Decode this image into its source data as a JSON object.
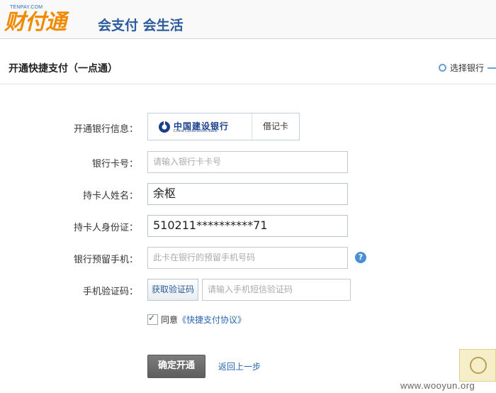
{
  "header": {
    "logo_small": "TENPAY.COM",
    "logo_main": "财付通",
    "slogan": "会支付 会生活"
  },
  "title_bar": {
    "title": "开通快捷支付（一点通）",
    "step_label": "选择银行"
  },
  "form": {
    "bank_info": {
      "label": "开通银行信息：",
      "bank_name": "中国建设银行",
      "bank_name_en": "China Construction Bank",
      "card_type": "借记卡"
    },
    "card_number": {
      "label": "银行卡号：",
      "placeholder": "请输入银行卡卡号",
      "value": ""
    },
    "holder_name": {
      "label": "持卡人姓名：",
      "value": "余枢"
    },
    "id_number": {
      "label": "持卡人身份证：",
      "value": "510211**********71"
    },
    "phone": {
      "label": "银行预留手机：",
      "placeholder": "此卡在银行的预留手机号码",
      "help_icon": "?"
    },
    "sms_code": {
      "label": "手机验证码：",
      "button_label": "获取验证码",
      "placeholder": "请输入手机短信验证码"
    },
    "agreement": {
      "checked": true,
      "prefix": "同意",
      "link_text": "《快捷支付协议》"
    }
  },
  "actions": {
    "confirm_label": "确定开通",
    "back_label": "返回上一步"
  },
  "watermark": "www.wooyun.org",
  "colors": {
    "logo_orange": "#f08a00",
    "brand_blue": "#2c5b9f",
    "link_blue": "#2a66b0",
    "button_gray": "#6b6b6b"
  }
}
